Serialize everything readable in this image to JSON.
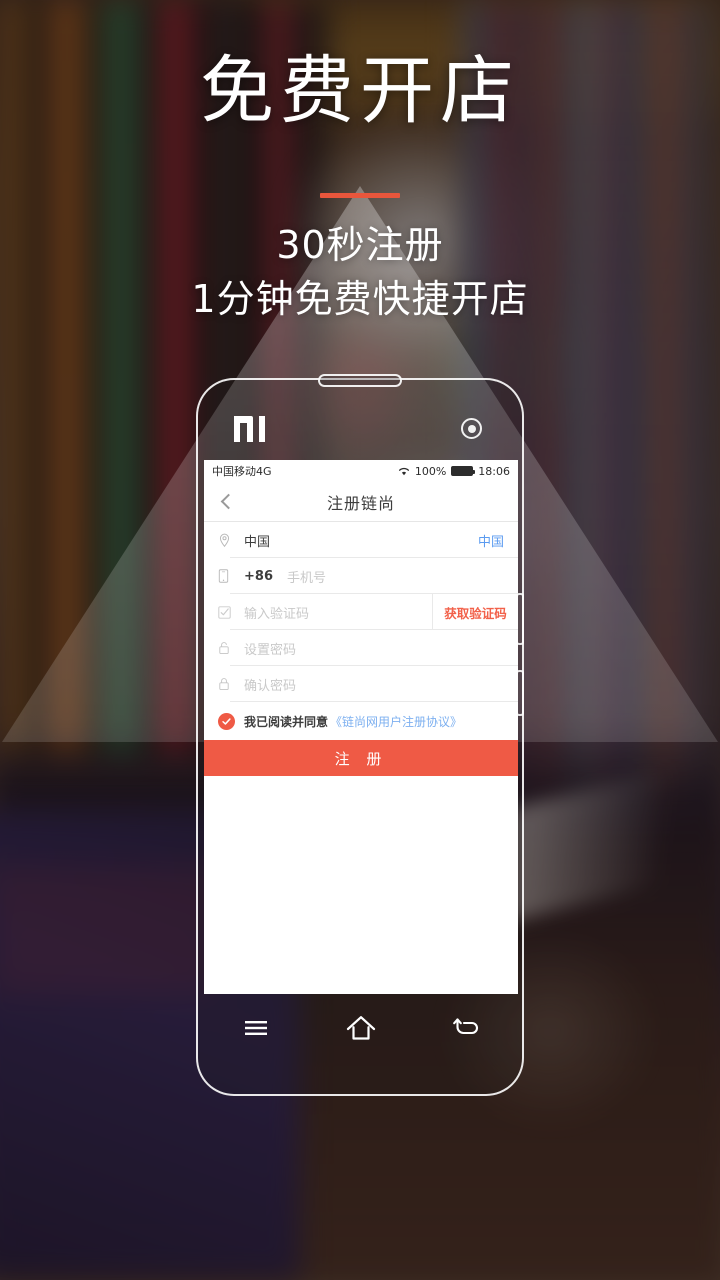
{
  "promo": {
    "headline": "免费开店",
    "sub_line1": "30秒注册",
    "sub_line2": "1分钟免费快捷开店",
    "accent_color": "#e8563c"
  },
  "phone": {
    "brand_logo": "mi-logo",
    "front_camera": "front-camera-icon",
    "speaker": "earpiece-speaker",
    "volume_button": "volume-button",
    "power_button": "power-button",
    "softkeys": [
      {
        "name": "menu",
        "icon": "menu-icon"
      },
      {
        "name": "home",
        "icon": "home-icon"
      },
      {
        "name": "back",
        "icon": "back-arrow-icon"
      }
    ]
  },
  "statusbar": {
    "carrier": "中国移动4G",
    "wifi_icon": "wifi-icon",
    "battery_percent": "100%",
    "battery_icon": "battery-full-icon",
    "time": "18:06"
  },
  "navbar": {
    "back_icon": "chevron-left-icon",
    "title": "注册链尚"
  },
  "form": {
    "country_row": {
      "icon": "location-pin-icon",
      "value": "中国",
      "link_label": "中国"
    },
    "phone_row": {
      "icon": "mobile-phone-icon",
      "prefix": "+86",
      "placeholder": "手机号",
      "value": ""
    },
    "code_row": {
      "icon": "checkbox-outline-icon",
      "placeholder": "输入验证码",
      "value": "",
      "button_label": "获取验证码"
    },
    "password_row": {
      "icon": "lock-open-icon",
      "placeholder": "设置密码",
      "value": ""
    },
    "confirm_row": {
      "icon": "lock-closed-icon",
      "placeholder": "确认密码",
      "value": ""
    },
    "agreement": {
      "checked": true,
      "check_icon": "check-circle-icon",
      "text": "我已阅读并同意",
      "link": "《链尚网用户注册协议》"
    },
    "submit_label": "注 册",
    "submit_color": "#ef5a45",
    "link_color": "#5b9bf0",
    "code_color": "#f2614a"
  }
}
